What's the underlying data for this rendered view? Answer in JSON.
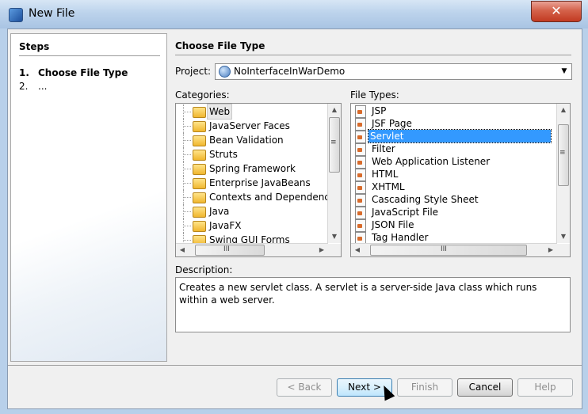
{
  "window": {
    "title": "New File",
    "close_glyph": "✕",
    "app_icon": "netbeans-cube-icon"
  },
  "steps": {
    "title": "Steps",
    "items": [
      {
        "num": "1.",
        "label": "Choose File Type"
      },
      {
        "num": "2.",
        "label": "..."
      }
    ]
  },
  "main": {
    "title": "Choose File Type",
    "project_label": "Project:",
    "project_value": "NoInterfaceInWarDemo",
    "categories_label": "Categories:",
    "filetypes_label": "File Types:",
    "categories": [
      "Web",
      "JavaServer Faces",
      "Bean Validation",
      "Struts",
      "Spring Framework",
      "Enterprise JavaBeans",
      "Contexts and Dependency Injection",
      "Java",
      "JavaFX",
      "Swing GUI Forms"
    ],
    "selected_category": "Web",
    "file_types": [
      "JSP",
      "JSF Page",
      "Servlet",
      "Filter",
      "Web Application Listener",
      "HTML",
      "XHTML",
      "Cascading Style Sheet",
      "JavaScript File",
      "JSON File",
      "Tag Handler"
    ],
    "selected_file_type": "Servlet",
    "description_label": "Description:",
    "description": "Creates a new servlet class. A servlet is a server-side Java class which runs within a web server."
  },
  "buttons": {
    "back": "< Back",
    "next": "Next >",
    "finish": "Finish",
    "cancel": "Cancel",
    "help": "Help"
  },
  "scroll_glyphs": {
    "up": "▲",
    "down": "▼",
    "left": "◀",
    "right": "▶",
    "grip_v": "≡",
    "grip_h": "III",
    "combo_arrow": "▼"
  },
  "colors": {
    "selection": "#3399ff",
    "title_gradient_top": "#d7e6f5",
    "close_button": "#c23a21",
    "dialog_bg": "#f0f0f0"
  }
}
